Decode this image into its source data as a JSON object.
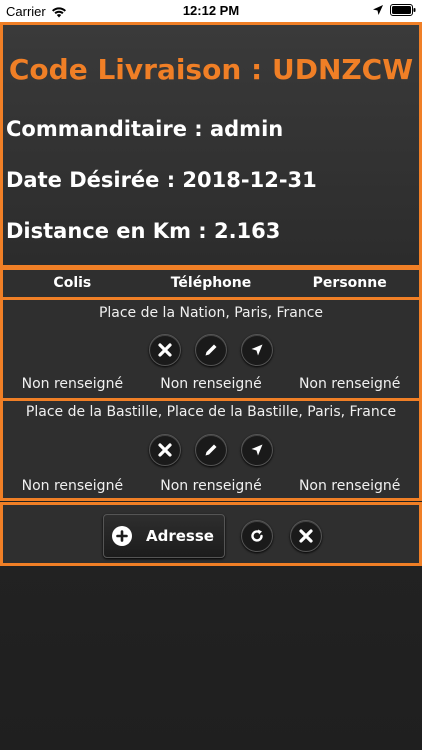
{
  "status_bar": {
    "carrier": "Carrier",
    "time": "12:12 PM"
  },
  "header": {
    "code_title": "Code Livraison : UDNZCW",
    "commanditaire": "Commanditaire : admin",
    "date": "Date Désirée : 2018-12-31",
    "distance": "Distance en Km : 2.163"
  },
  "table": {
    "columns": [
      "Colis",
      "Téléphone",
      "Personne"
    ],
    "rows": [
      {
        "address": "Place de la Nation, Paris, France",
        "values": [
          "Non renseigné",
          "Non renseigné",
          "Non renseigné"
        ]
      },
      {
        "address": "Place de la Bastille, Place de la Bastille, Paris, France",
        "values": [
          "Non renseigné",
          "Non renseigné",
          "Non renseigné"
        ]
      }
    ]
  },
  "actions": {
    "add_label": "Adresse"
  },
  "colors": {
    "accent": "#f07f26",
    "background": "#2f2f2f"
  },
  "icons": [
    "wifi-icon",
    "location-arrow-icon",
    "battery-icon",
    "close-icon",
    "edit-icon",
    "navigate-icon",
    "plus-icon",
    "refresh-icon"
  ]
}
